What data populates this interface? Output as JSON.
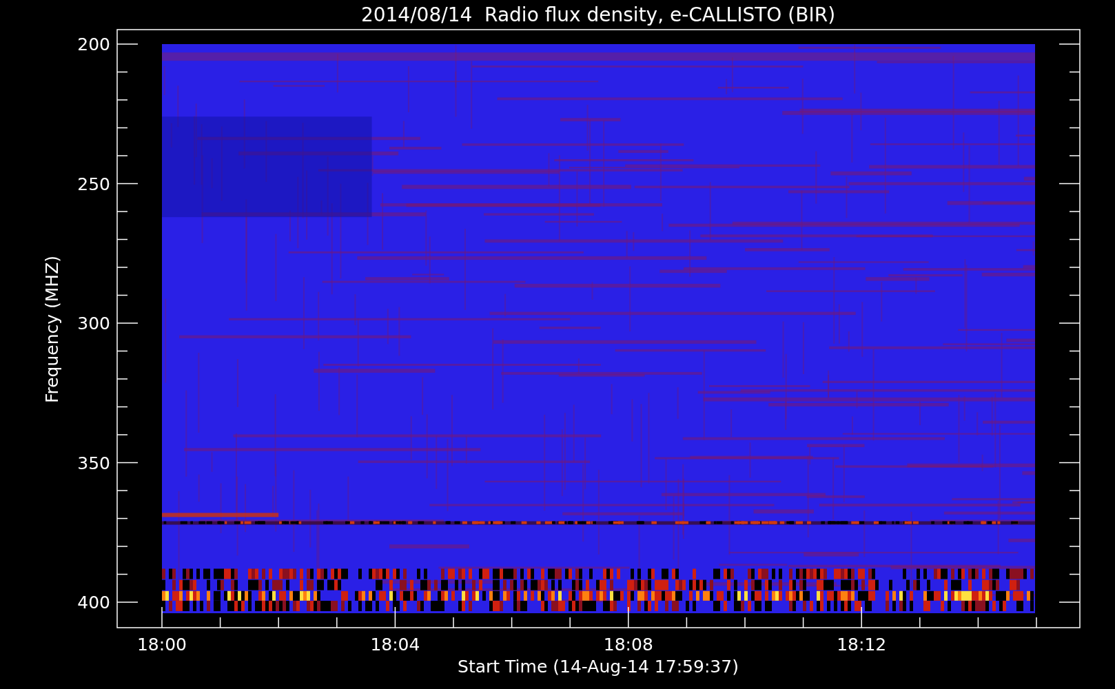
{
  "plot": {
    "title": "2014/08/14  Radio flux density, e-CALLISTO (BIR)",
    "ylabel": "Frequency (MHZ)",
    "xlabel": "Start Time (14-Aug-14 17:59:37)",
    "yticks": [
      "200",
      "250",
      "300",
      "350",
      "400"
    ],
    "xticks": [
      "18:00",
      "18:04",
      "18:08",
      "18:12"
    ]
  }
}
